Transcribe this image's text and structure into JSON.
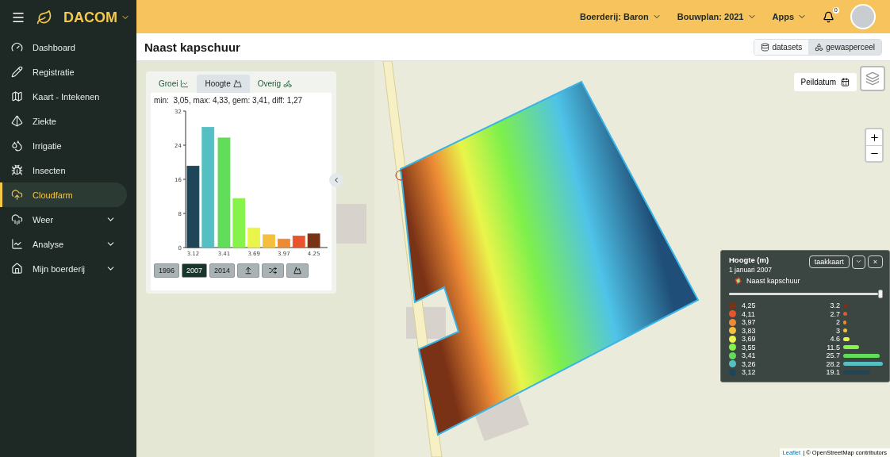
{
  "brand": {
    "name": "DACOM"
  },
  "sidebar": {
    "items": [
      {
        "label": "Dashboard",
        "kind": "link",
        "selected": false
      },
      {
        "label": "Registratie",
        "kind": "link",
        "selected": false
      },
      {
        "label": "Kaart - Intekenen",
        "kind": "link",
        "selected": false
      },
      {
        "label": "Ziekte",
        "kind": "link",
        "selected": false
      },
      {
        "label": "Irrigatie",
        "kind": "link",
        "selected": false
      },
      {
        "label": "Insecten",
        "kind": "link",
        "selected": false
      },
      {
        "label": "Cloudfarm",
        "kind": "link",
        "selected": true
      },
      {
        "label": "Weer",
        "kind": "group",
        "selected": false
      },
      {
        "label": "Analyse",
        "kind": "group",
        "selected": false
      },
      {
        "label": "Mijn boerderij",
        "kind": "group",
        "selected": false
      }
    ]
  },
  "topbar": {
    "menus": [
      "Boerderij: Baron",
      "Bouwplan: 2021",
      "Apps"
    ],
    "notifications": "0"
  },
  "page": {
    "title": "Naast kapschuur",
    "views": [
      {
        "label": "datasets",
        "selected": false
      },
      {
        "label": "gewasperceel",
        "selected": true
      }
    ]
  },
  "map": {
    "peildatum": "Peildatum",
    "attribution": {
      "link": "Leaflet",
      "text": "| © OpenStreetMap contributors"
    }
  },
  "panel": {
    "tabs": [
      {
        "label": "Groei",
        "selected": false
      },
      {
        "label": "Hoogte",
        "selected": true
      },
      {
        "label": "Overig",
        "selected": false
      }
    ],
    "stats": "min:  3,05, max: 4,33, gem: 3,41, diff: 1,27",
    "chart_data": {
      "type": "bar",
      "ylim": [
        0,
        32
      ],
      "yticks": [
        0,
        8,
        16,
        24,
        32
      ],
      "x": [
        3.12,
        3.26,
        3.41,
        3.55,
        3.69,
        3.83,
        3.97,
        4.11,
        4.25
      ],
      "xticks": [
        3.12,
        3.41,
        3.69,
        3.97,
        4.25
      ],
      "xlim": [
        3.05,
        4.32
      ],
      "series": [
        {
          "values": [
            19.1,
            28.2,
            25.7,
            11.5,
            4.6,
            3,
            2,
            2.7,
            3.2
          ]
        }
      ]
    },
    "years": [
      {
        "label": "1996",
        "selected": false
      },
      {
        "label": "2007",
        "selected": true
      },
      {
        "label": "2014",
        "selected": false
      }
    ]
  },
  "legend": {
    "title": "Hoogte (m)",
    "date": "1 januari 2007",
    "field": "Naast kapschuur",
    "button": "taakkaart",
    "close": "×",
    "slider": {
      "level": 1
    },
    "items": [
      {
        "label": "4,25",
        "value": "3.2",
        "color": "#7a3216"
      },
      {
        "label": "4,11",
        "value": "2.7",
        "color": "#e8552a"
      },
      {
        "label": "3,97",
        "value": "2",
        "color": "#ec8a35"
      },
      {
        "label": "3,83",
        "value": "3",
        "color": "#f5bf3e"
      },
      {
        "label": "3,69",
        "value": "4.6",
        "color": "#e9f54a"
      },
      {
        "label": "3,55",
        "value": "11.5",
        "color": "#86f24a"
      },
      {
        "label": "3,41",
        "value": "25.7",
        "color": "#62dd5a"
      },
      {
        "label": "3,26",
        "value": "28.2",
        "color": "#55bfc4"
      },
      {
        "label": "3,12",
        "value": "19.1",
        "color": "#1f4658"
      }
    ]
  }
}
